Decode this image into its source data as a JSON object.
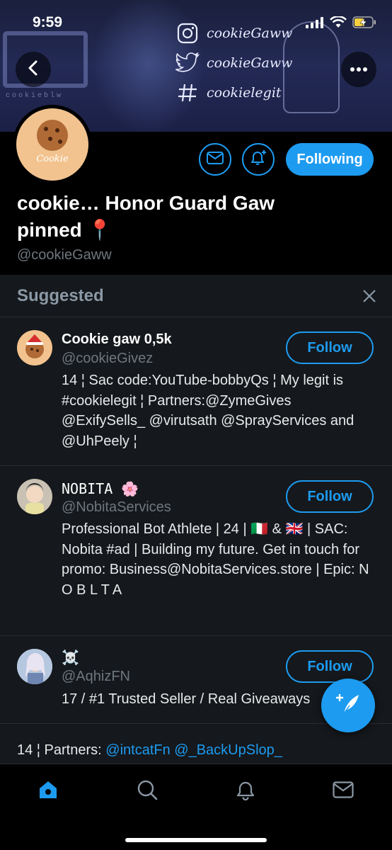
{
  "status_bar": {
    "time": "9:59"
  },
  "banner": {
    "logo_text": "cookieblw",
    "socials": [
      {
        "icon": "instagram-icon",
        "text": "cookieGaww"
      },
      {
        "icon": "twitter-icon",
        "text": "cookieGaww"
      },
      {
        "icon": "hashtag-icon",
        "text": "cookielegit"
      }
    ]
  },
  "profile": {
    "avatar_label": "Cookie",
    "display_name": "cookie… Honor Guard Gaw pinned 📍",
    "handle": "@cookieGaww",
    "following_label": "Following"
  },
  "suggested": {
    "title": "Suggested",
    "items": [
      {
        "name": "Cookie gaw 0,5k",
        "handle": "@cookieGivez",
        "bio": "14 ¦ Sac code:YouTube-bobbyQs ¦ My legit is #cookielegit ¦ Partners:@ZymeGives @ExifySells_ @virutsath @SprayServices and @UhPeely ¦",
        "follow_label": "Follow"
      },
      {
        "name": "NOBITA 🌸",
        "handle": "@NobitaServices",
        "bio": "Professional Bot Athlete | 24 | 🇮🇹 & 🇬🇧 | SAC: Nobita #ad | Building my future. Get in touch for promo: Business@NobitaServices.store | Epic: N O B L T A",
        "follow_label": "Follow"
      },
      {
        "name": "☠️",
        "handle": "@AqhizFN",
        "bio": "17 / #1 Trusted Seller / Real Giveaways",
        "follow_label": "Follow"
      }
    ]
  },
  "tweet_preview": {
    "text": "14 ¦ Partners: ",
    "mentions": "@intcatFn @_BackUpSlop_"
  },
  "colors": {
    "accent": "#1d9bf0",
    "panel": "#15181c",
    "muted": "#6e767d"
  }
}
